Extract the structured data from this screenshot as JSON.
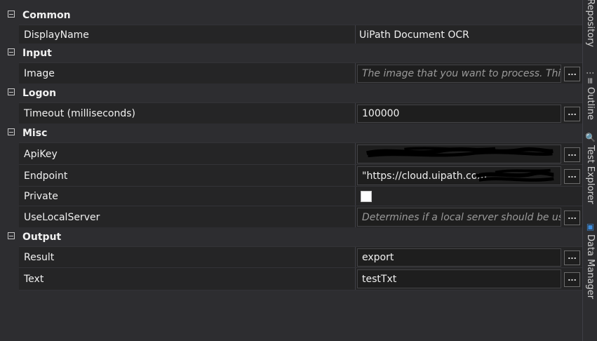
{
  "categories": [
    {
      "label": "Common",
      "rows": [
        {
          "name": "DisplayName",
          "kind": "plain",
          "value": "UiPath Document OCR"
        }
      ]
    },
    {
      "label": "Input",
      "rows": [
        {
          "name": "Image",
          "kind": "box",
          "placeholder": "The image that you want to process. This fie"
        }
      ]
    },
    {
      "label": "Logon",
      "rows": [
        {
          "name": "Timeout (milliseconds)",
          "kind": "box",
          "value": "100000"
        }
      ]
    },
    {
      "label": "Misc",
      "rows": [
        {
          "name": "ApiKey",
          "kind": "box",
          "value": ""
        },
        {
          "name": "Endpoint",
          "kind": "box",
          "value": "\"https://cloud.uipath.com"
        },
        {
          "name": "Private",
          "kind": "check",
          "checked": false
        },
        {
          "name": "UseLocalServer",
          "kind": "box",
          "placeholder": "Determines if a local server should be used"
        }
      ]
    },
    {
      "label": "Output",
      "rows": [
        {
          "name": "Result",
          "kind": "box",
          "value": "export"
        },
        {
          "name": "Text",
          "kind": "box",
          "value": "testTxt"
        }
      ]
    }
  ],
  "browse_label": "...",
  "side_tabs": [
    {
      "label": "Repository",
      "icon": "repository-icon",
      "glyph": ""
    },
    {
      "label": "Outline",
      "icon": "outline-icon",
      "glyph": "⋮≡"
    },
    {
      "label": "Test Explorer",
      "icon": "test-explorer-icon",
      "glyph": "🔍"
    },
    {
      "label": "Data Manager",
      "icon": "data-manager-icon",
      "glyph": "▣"
    }
  ]
}
